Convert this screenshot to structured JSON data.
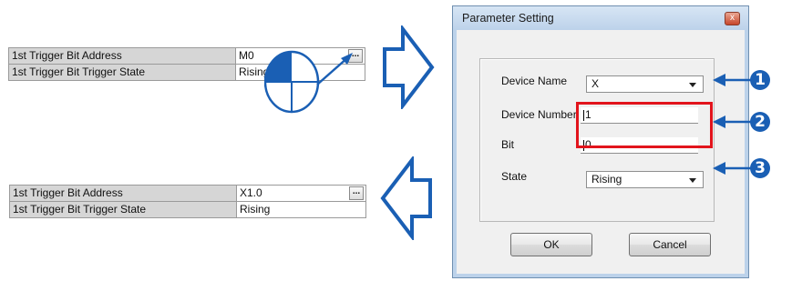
{
  "top_grid": {
    "rows": [
      {
        "label": "1st Trigger Bit Address",
        "value": "M0",
        "button": "..."
      },
      {
        "label": "1st Trigger Bit Trigger State",
        "value": "Rising"
      }
    ]
  },
  "bottom_grid": {
    "rows": [
      {
        "label": "1st Trigger Bit Address",
        "value": "X1.0",
        "button": "..."
      },
      {
        "label": "1st Trigger Bit Trigger State",
        "value": "Rising"
      }
    ]
  },
  "dialog": {
    "title": "Parameter Setting",
    "close_glyph": "x",
    "device_name_label": "Device Name",
    "device_name_value": "X",
    "device_number_label": "Device Number",
    "device_number_value": "1",
    "bit_label": "Bit",
    "bit_value": "0",
    "state_label": "State",
    "state_value": "Rising",
    "ok_label": "OK",
    "cancel_label": "Cancel"
  },
  "callouts": {
    "one": "1",
    "two": "2",
    "three": "3"
  },
  "colors": {
    "arrow_blue": "#1a5fb4",
    "highlight_red": "#e2141c",
    "label_cell": "#d6d6d6"
  },
  "icons": [
    "mouse-icon",
    "right-arrow-icon",
    "left-arrow-icon",
    "dropdown-arrow-icon",
    "close-icon"
  ]
}
